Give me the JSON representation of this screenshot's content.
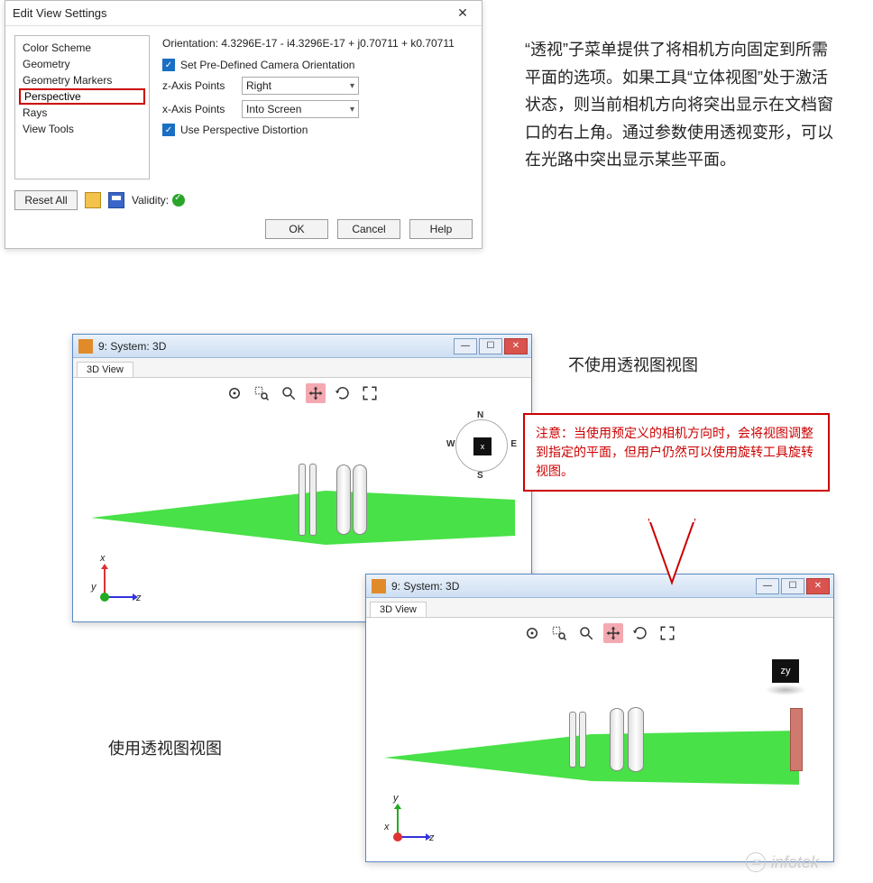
{
  "dialog": {
    "title": "Edit View Settings",
    "categories": [
      "Color Scheme",
      "Geometry",
      "Geometry Markers",
      "Perspective",
      "Rays",
      "View Tools"
    ],
    "selected_index": 3,
    "orientation_label": "Orientation:",
    "orientation_value": "4.3296E-17 - i4.3296E-17 + j0.70711 + k0.70711",
    "set_predef_label": "Set Pre-Defined Camera Orientation",
    "z_axis_label": "z-Axis Points",
    "z_axis_value": "Right",
    "x_axis_label": "x-Axis Points",
    "x_axis_value": "Into Screen",
    "use_persp_label": "Use Perspective Distortion",
    "reset_all": "Reset All",
    "validity_label": "Validity:",
    "buttons": {
      "ok": "OK",
      "cancel": "Cancel",
      "help": "Help"
    }
  },
  "desc1": "“透视”子菜单提供了将相机方向固定到所需平面的选项。如果工具“立体视图”处于激活状态，则当前相机方向将突出显示在文档窗口的右上角。通过参数使用透视变形，可以在光路中突出显示某些平面。",
  "caption1": "不使用透视图视图",
  "caption2": "使用透视图视图",
  "callout": "注意：当使用预定义的相机方向时，会将视图调整到指定的平面，但用户仍然可以使用旋转工具旋转视图。",
  "win": {
    "title": "9: System: 3D",
    "tab": "3D View"
  },
  "compass": {
    "n": "N",
    "s": "S",
    "e": "E",
    "w": "W",
    "cube": "x"
  },
  "cube2": "zy",
  "axis1": {
    "up": "x",
    "right": "z",
    "in": "y"
  },
  "axis2": {
    "up": "y",
    "right": "z",
    "in": "x"
  },
  "tools": [
    "view",
    "zoom-area",
    "zoom",
    "move",
    "rotate",
    "fit"
  ],
  "watermark": "infotek"
}
